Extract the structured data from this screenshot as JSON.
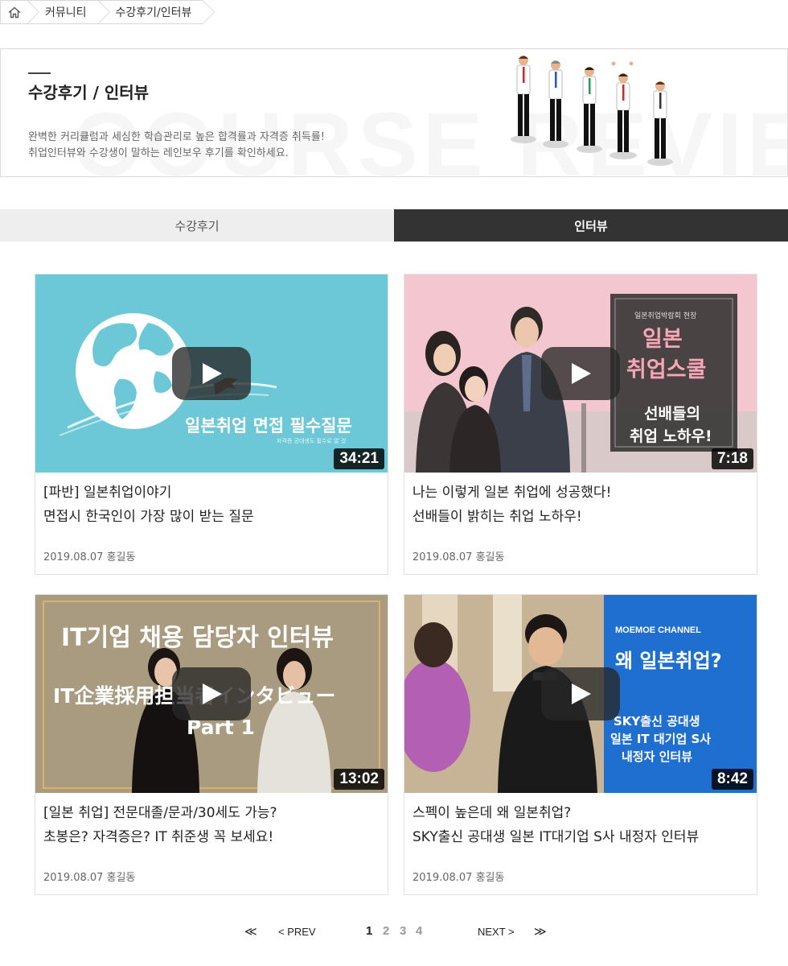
{
  "breadcrumb": {
    "items": [
      "커뮤니티",
      "수강후기/인터뷰"
    ]
  },
  "banner": {
    "title": "수강후기 / 인터뷰",
    "watermark": "COURSE REVIEW",
    "desc_line1": "완벽한 커리큘럼과 세심한 학습관리로 높은 합격률과 자격증 취득률!",
    "desc_line2": "취업인터뷰와 수강생이 말하는 레인보우 후기를 확인하세요."
  },
  "tabs": [
    {
      "label": "수강후기",
      "active": false
    },
    {
      "label": "인터뷰",
      "active": true
    }
  ],
  "videos": [
    {
      "thumb_text": "일본취업 면접 필수질문",
      "thumb_sub": "자격증 공대생도 필수로 알 것",
      "duration": "34:21",
      "title_line1": "[파반] 일본취업이야기",
      "title_line2": "면접시 한국인이 가장 많이 받는 질문",
      "date": "2019.08.07",
      "author": "홍길동"
    },
    {
      "thumb_small": "일본취업박람회 현장",
      "thumb_text1": "일본",
      "thumb_text2": "취업스쿨",
      "thumb_text3": "선배들의",
      "thumb_text4": "취업 노하우!",
      "duration": "7:18",
      "title_line1": "나는 이렇게 일본 취업에 성공했다!",
      "title_line2": "선배들이 밝히는 취업 노하우!",
      "date": "2019.08.07",
      "author": "홍길동"
    },
    {
      "thumb_text1": "IT기업 채용 담당자 인터뷰",
      "thumb_text2": "IT企業採用担当者インタビュー",
      "thumb_text3": "Part 1",
      "duration": "13:02",
      "title_line1": "[일본 취업] 전문대졸/문과/30세도 가능?",
      "title_line2": "초봉은? 자격증은? IT 취준생 꼭 보세요!",
      "date": "2019.08.07",
      "author": "홍길동"
    },
    {
      "thumb_channel": "MOEMOE CHANNEL",
      "thumb_text1": "왜 일본취업?",
      "thumb_text2": "SKY출신 공대생",
      "thumb_text3": "일본 IT 대기업 S사",
      "thumb_text4": "내정자 인터뷰",
      "duration": "8:42",
      "title_line1": "스펙이 높은데 왜 일본취업?",
      "title_line2": "SKY출신 공대생 일본 IT대기업 S사 내정자 인터뷰",
      "date": "2019.08.07",
      "author": "홍길동"
    }
  ],
  "pagination": {
    "first": "≪",
    "prev": "< PREV",
    "pages": [
      "1",
      "2",
      "3",
      "4"
    ],
    "current": "1",
    "next": "NEXT >",
    "last": "≫"
  },
  "colors": {
    "active_tab": "#333333",
    "inactive_tab": "#eeeeee",
    "thumb1_bg": "#6cc8d6",
    "thumb2_bg": "#f4c6cf",
    "thumb4_bg": "#1f6fd1"
  },
  "icons": {
    "home": "home-icon",
    "play": "play-icon"
  }
}
